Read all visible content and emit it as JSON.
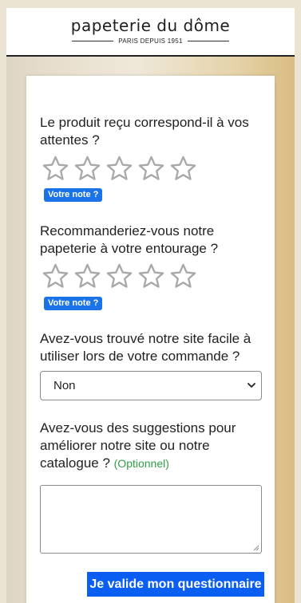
{
  "brand": {
    "name": "papeterie du dôme",
    "tagline": "PARIS DEPUIS 1951"
  },
  "questions": [
    {
      "text": "Le produit reçu correspond-il à vos attentes ?",
      "type": "stars",
      "max_rating": 5,
      "rating": 0,
      "badge": "Votre note ?"
    },
    {
      "text": "Recommanderiez-vous notre papeterie à votre entourage ?",
      "type": "stars",
      "max_rating": 5,
      "rating": 0,
      "badge": "Votre note ?"
    },
    {
      "text": "Avez-vous trouvé notre site facile à utiliser lors de votre commande ?",
      "type": "select",
      "selected": "Non"
    },
    {
      "text": "Avez-vous des suggestions pour améliorer notre site ou notre catalogue ?",
      "optional_label": "(Optionnel)",
      "type": "textarea",
      "value": ""
    }
  ],
  "submit_label": "Je valide mon questionnaire",
  "colors": {
    "accent_blue": "#0a5ff2",
    "badge_blue": "#1a73e8",
    "optional_green": "#2e9f45",
    "star_outline": "#a8a8a8"
  }
}
